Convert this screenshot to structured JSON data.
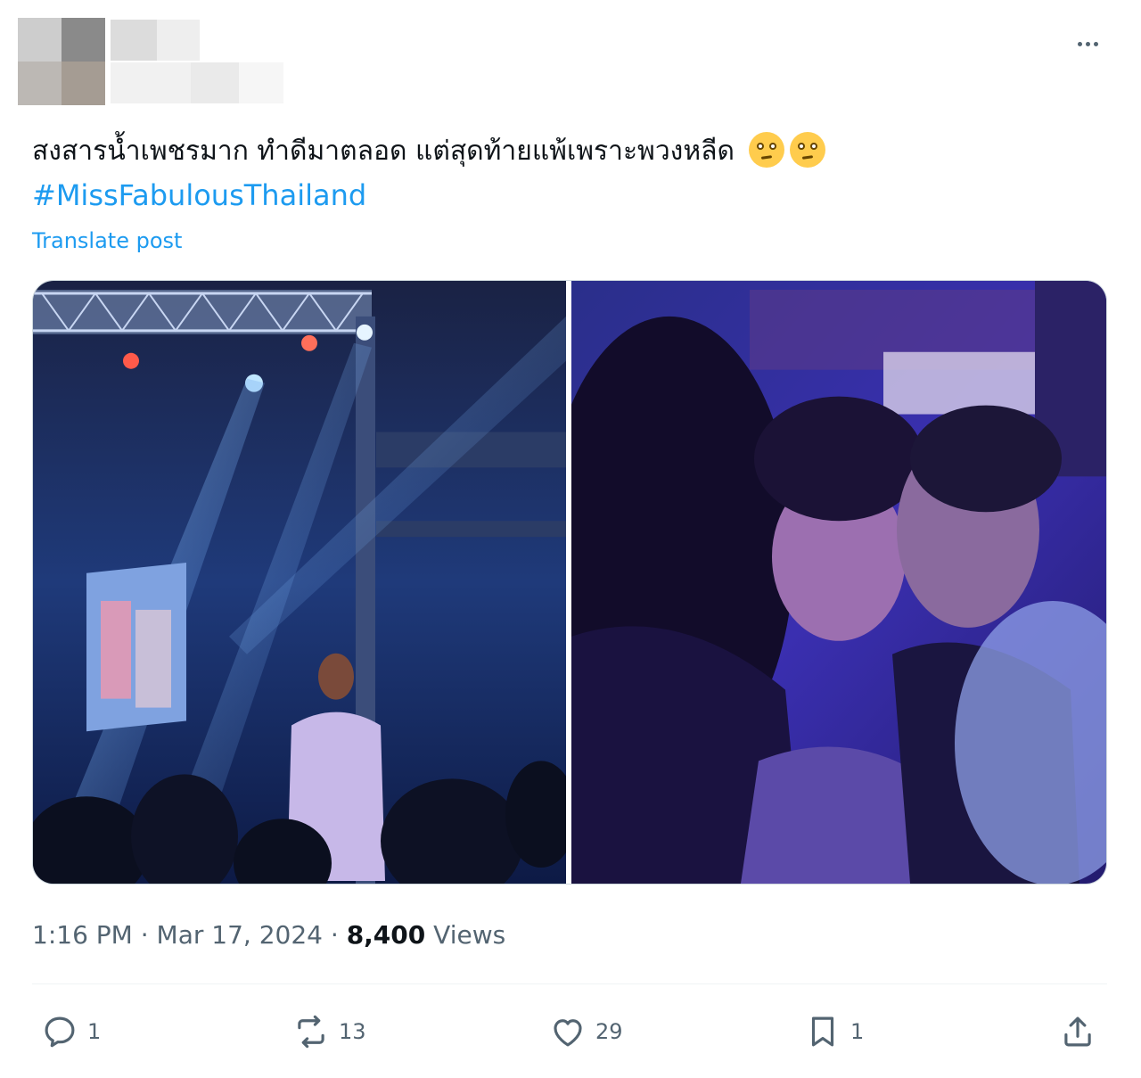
{
  "tweet": {
    "text": "สงสารน้ำเพชรมาก ทำดีมาตลอด แต่สุดท้ายแพ้เพราะพวงหลีด",
    "emoji": [
      "face-with-rolling-eyes",
      "face-with-rolling-eyes"
    ],
    "hashtag": "#MissFabulousThailand",
    "translate_label": "Translate post",
    "time": "1:16 PM",
    "separator": "·",
    "date": "Mar 17, 2024",
    "views_count": "8,400",
    "views_label": "Views"
  },
  "media": [
    {
      "name": "stage-photo",
      "description": "contestant on blue-lit stage"
    },
    {
      "name": "crowd-hug-photo",
      "description": "contestant being hugged"
    }
  ],
  "actions": {
    "reply_count": "1",
    "repost_count": "13",
    "like_count": "29",
    "bookmark_count": "1"
  },
  "icons": {
    "more": "more-icon",
    "reply": "reply-icon",
    "repost": "repost-icon",
    "like": "like-icon",
    "bookmark": "bookmark-icon",
    "share": "share-icon"
  },
  "colors": {
    "link": "#1d9bf0",
    "secondary_text": "#536471",
    "primary_text": "#0f1419"
  }
}
